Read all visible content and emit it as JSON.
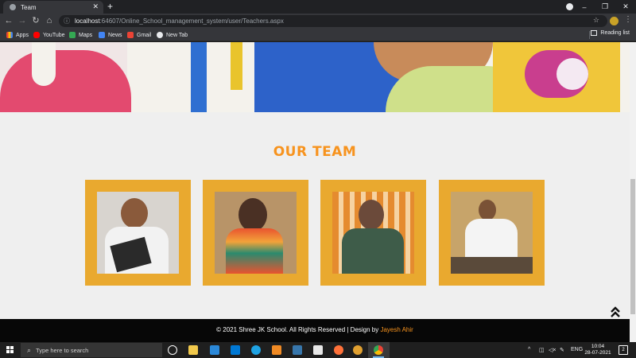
{
  "browser": {
    "tab_title": "Team",
    "tab_close_icon": "close-icon",
    "new_tab_icon": "plus-icon",
    "url_host": "localhost",
    "url_rest": ":64607/Online_School_management_system/user/Teachers.aspx",
    "window_controls": [
      "–",
      "❐",
      "✕"
    ],
    "bookmarks": [
      {
        "label": "Apps",
        "icon": "apps-grid-icon",
        "color": "#e8eaed"
      },
      {
        "label": "YouTube",
        "icon": "youtube-icon",
        "color": "#ff0000"
      },
      {
        "label": "Maps",
        "icon": "maps-icon",
        "color": "#34a853"
      },
      {
        "label": "News",
        "icon": "news-icon",
        "color": "#4285f4"
      },
      {
        "label": "Gmail",
        "icon": "gmail-icon",
        "color": "#ea4335"
      },
      {
        "label": "New Tab",
        "icon": "globe-icon",
        "color": "#e8eaed"
      }
    ],
    "reading_list": "Reading list"
  },
  "page": {
    "section_title": "OUR TEAM",
    "accent_color": "#f7931e",
    "card_color": "#e9a92f",
    "team_cards": [
      {
        "photo": "teacher-photo-1"
      },
      {
        "photo": "teacher-photo-2"
      },
      {
        "photo": "teacher-photo-3"
      },
      {
        "photo": "teacher-photo-4"
      }
    ],
    "footer": {
      "copyright": "© 2021 Shree JK School. All Rights Reserved | Design by ",
      "author": "Jayesh Ahir"
    },
    "back_to_top_icon": "double-chevron-up-icon"
  },
  "taskbar": {
    "search_placeholder": "Type here to search",
    "tray_language": "ENG",
    "time": "10:04",
    "date": "28-07-2021",
    "notification_count": "2"
  }
}
